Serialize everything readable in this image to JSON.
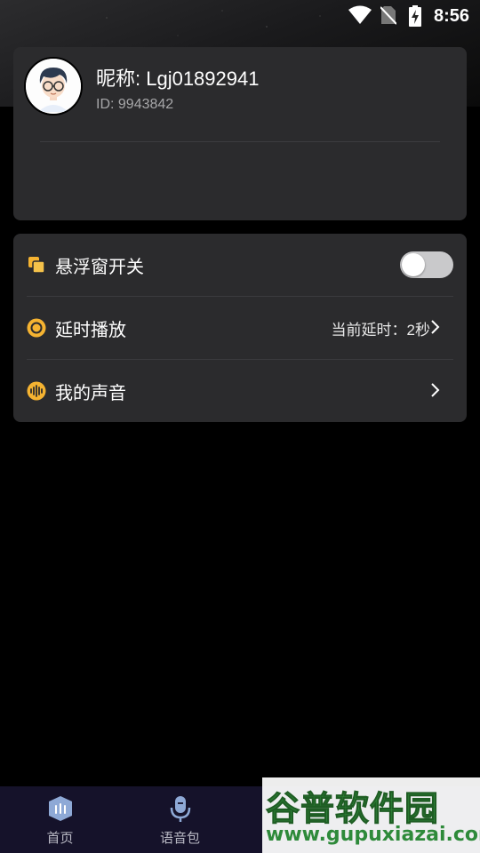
{
  "status_bar": {
    "time": "8:56",
    "icons": [
      "wifi-icon",
      "no-sim-icon",
      "battery-charging-icon"
    ]
  },
  "profile": {
    "nickname": "昵称: Lgj01892941",
    "id": "ID: 9943842",
    "avatar": "avatar-cartoon-glasses"
  },
  "settings": {
    "items": [
      {
        "label": "悬浮窗开关",
        "icon": "floating-window-icon",
        "control": "toggle",
        "toggle_on": false
      },
      {
        "label": "延时播放",
        "icon": "delay-icon",
        "value": "当前延时：2秒",
        "control": "chevron"
      },
      {
        "label": "我的声音",
        "icon": "voice-wave-icon",
        "control": "chevron"
      }
    ]
  },
  "bottom_nav": {
    "items": [
      {
        "label": "首页",
        "icon": "home-bars-icon"
      },
      {
        "label": "语音包",
        "icon": "microphone-icon"
      }
    ]
  },
  "watermark": {
    "title": "谷普软件园",
    "url": "www.gupuxiazai.com"
  },
  "colors": {
    "accent": "#f5b331",
    "card": "#2b2b2d",
    "nav_bg": "#15122a",
    "toggle_off": "#c9c9cb"
  }
}
